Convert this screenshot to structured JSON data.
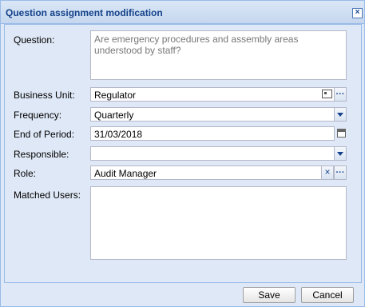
{
  "dialog": {
    "title": "Question assignment modification"
  },
  "form": {
    "question_label": "Question:",
    "question_value": "Are emergency procedures and assembly areas understood by staff?",
    "business_unit_label": "Business Unit:",
    "business_unit_value": "Regulator",
    "frequency_label": "Frequency:",
    "frequency_value": "Quarterly",
    "end_of_period_label": "End of Period:",
    "end_of_period_value": "31/03/2018",
    "responsible_label": "Responsible:",
    "responsible_value": "",
    "role_label": "Role:",
    "role_value": "Audit Manager",
    "matched_users_label": "Matched Users:",
    "matched_users_value": ""
  },
  "buttons": {
    "save": "Save",
    "cancel": "Cancel"
  },
  "icons": {
    "close": "close-icon",
    "business_card": "id-card-icon",
    "browse": "ellipsis-icon",
    "dropdown": "chevron-down-icon",
    "calendar": "calendar-icon",
    "clear": "clear-x-icon"
  },
  "colors": {
    "title_text": "#15428b",
    "panel_bg": "#dfe8f6",
    "border": "#99bbe8"
  }
}
